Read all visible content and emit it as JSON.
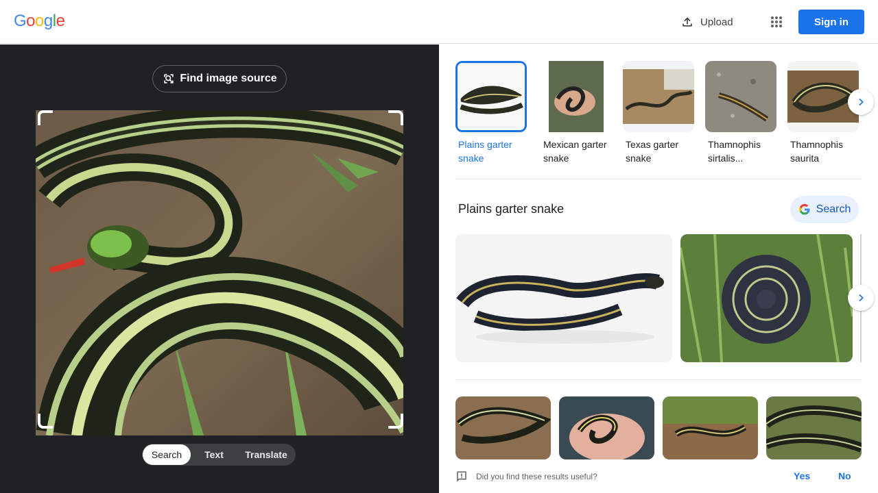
{
  "header": {
    "logo_letters": [
      "G",
      "o",
      "o",
      "g",
      "l",
      "e"
    ],
    "logo_colors": [
      "#4285F4",
      "#EA4335",
      "#FBBC05",
      "#4285F4",
      "#34A853",
      "#EA4335"
    ],
    "upload_label": "Upload",
    "signin_label": "Sign in"
  },
  "left_panel": {
    "find_source_label": "Find image source",
    "modes": [
      {
        "label": "Search",
        "active": true
      },
      {
        "label": "Text",
        "active": false
      },
      {
        "label": "Translate",
        "active": false
      }
    ]
  },
  "right_panel": {
    "entities": [
      {
        "label": "Plains garter snake",
        "selected": true
      },
      {
        "label": "Mexican garter snake",
        "selected": false
      },
      {
        "label": "Texas garter snake",
        "selected": false
      },
      {
        "label": "Thamnophis sirtalis...",
        "selected": false
      },
      {
        "label": "Thamnophis saurita",
        "selected": false
      }
    ],
    "section_title": "Plains garter snake",
    "search_chip_label": "Search",
    "feedback_question": "Did you find these results useful?",
    "feedback_yes": "Yes",
    "feedback_no": "No"
  },
  "colors": {
    "accent": "#1a73e8",
    "left_bg": "#202124"
  }
}
